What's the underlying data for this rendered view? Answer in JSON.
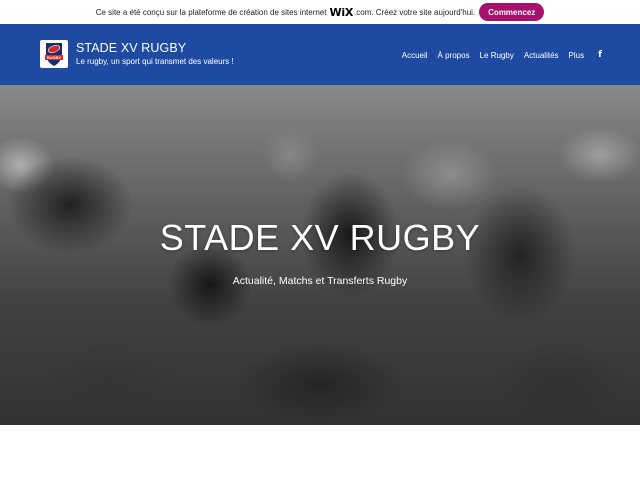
{
  "wix_banner": {
    "text_before": "Ce site a été conçu sur la plateforme de création de sites internet",
    "brand": "WiX",
    "text_after": ".com. Créez votre site aujourd'hui.",
    "button_label": "Commencez"
  },
  "header": {
    "title": "STADE XV RUGBY",
    "tagline": "Le rugby, un sport qui transmet des valeurs !",
    "logo_text": "RUGBY",
    "nav": [
      {
        "label": "Accueil"
      },
      {
        "label": "À propos"
      },
      {
        "label": "Le Rugby"
      },
      {
        "label": "Actualités"
      },
      {
        "label": "Plus"
      }
    ],
    "social_icon": "facebook-icon",
    "background_color": "#1f4aa2"
  },
  "hero": {
    "title": "STADE XV RUGBY",
    "subtitle": "Actualité, Matchs et Transferts Rugby"
  },
  "colors": {
    "banner_button": "#a4126e",
    "header": "#1f4aa2"
  }
}
